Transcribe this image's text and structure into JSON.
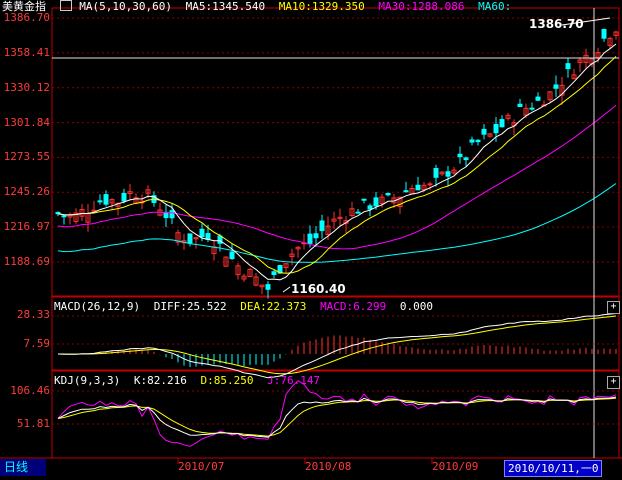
{
  "price_panel": {
    "symbol": "美黄金指",
    "ma_indicator": "MA(5,10,30,60)",
    "ma5": "MA5:1345.540",
    "ma10": "MA10:1329.350",
    "ma30": "MA30:1288.086",
    "ma60": "MA60:",
    "y_ticks": [
      "1386.70",
      "1358.41",
      "1330.12",
      "1301.84",
      "1273.55",
      "1245.26",
      "1216.97",
      "1188.69"
    ],
    "high_label": "1386.70",
    "low_label": "1160.40"
  },
  "macd_panel": {
    "indicator": "MACD(26,12,9)",
    "diff": "DIFF:25.522",
    "dea": "DEA:22.373",
    "macd": "MACD:6.299",
    "zero": "0.000",
    "y_ticks": [
      "28.33",
      "7.59"
    ]
  },
  "kdj_panel": {
    "indicator": "KDJ(9,3,3)",
    "k": "K:82.216",
    "d": "D:85.250",
    "j": "J:76.147",
    "y_ticks": [
      "106.46",
      "51.81"
    ]
  },
  "x_axis": {
    "period_tab": "日线",
    "months": [
      "2010/07",
      "2010/08",
      "2010/09"
    ],
    "cursor_date": "2010/10/11,一0"
  },
  "colors": {
    "up_candle": "#ff3030",
    "down_candle": "#00ffff",
    "ma5": "#ffffff",
    "ma10": "#ffff00",
    "ma30": "#ff00ff",
    "ma60": "#00ff00",
    "grid": "#ff0000",
    "axis_text": "#ff3b3b"
  },
  "icons": {
    "plus": "+",
    "ma_legend": "ma-legend-icon"
  }
}
